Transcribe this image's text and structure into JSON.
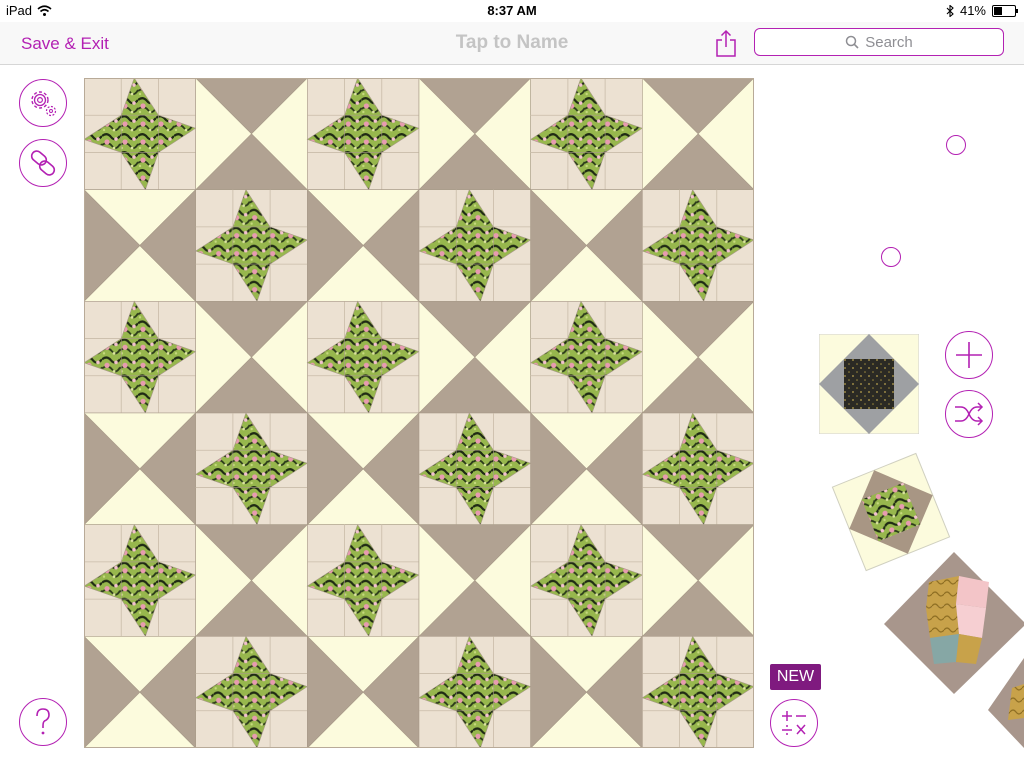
{
  "status_bar": {
    "device": "iPad",
    "time": "8:37 AM",
    "battery_text": "41%",
    "battery_level": 0.41
  },
  "nav": {
    "save_exit": "Save & Exit",
    "title": "Tap to Name",
    "search_placeholder": "Search"
  },
  "quilt": {
    "rows": 6,
    "cols": 6
  },
  "new_badge": "NEW",
  "icons": [
    "wifi-icon",
    "bluetooth-icon",
    "battery-icon",
    "share-icon",
    "search-icon",
    "settings-icon",
    "link-icon",
    "help-icon",
    "add-icon",
    "shuffle-icon",
    "calculator-icon"
  ],
  "colors": {
    "accent": "#b321b3",
    "badge": "#7f1a7f",
    "taupe": "#b1a292",
    "cream": "#fcfbdd",
    "beige": "#ece1d2",
    "floral_green": "#9cba52"
  }
}
